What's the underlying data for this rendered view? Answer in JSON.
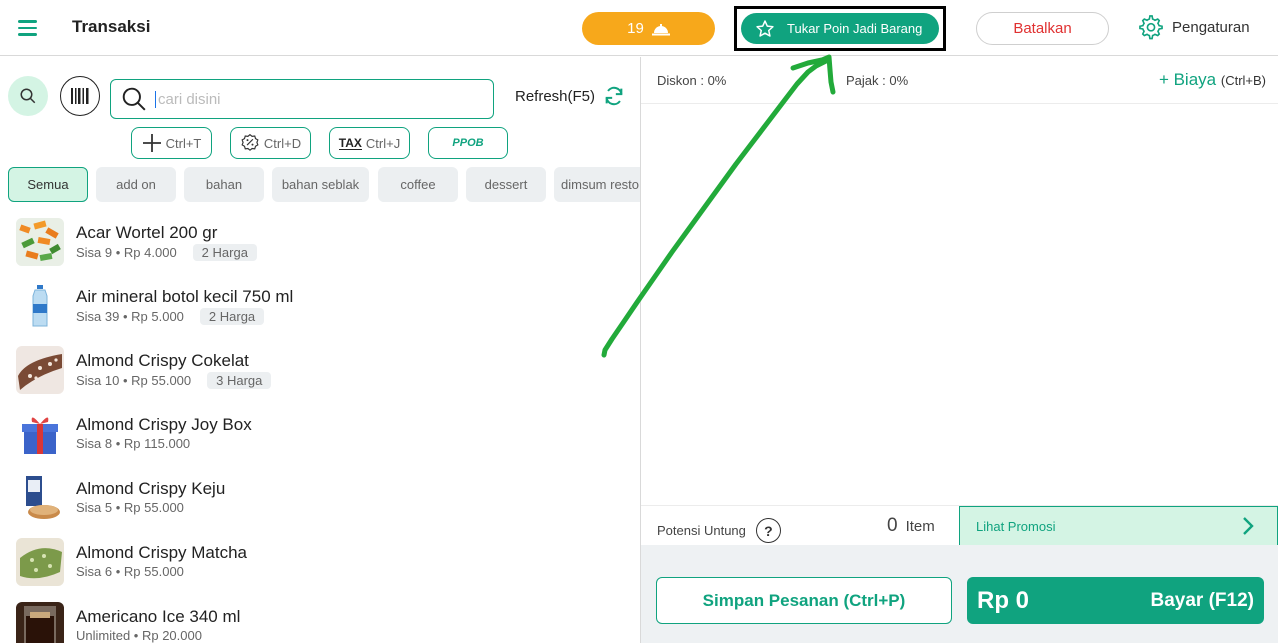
{
  "header": {
    "title": "Transaksi",
    "queue_count": "19",
    "tukar_label": "Tukar Poin Jadi Barang",
    "batal_label": "Batalkan",
    "setting_label": "Pengaturan"
  },
  "search": {
    "placeholder": "cari disini",
    "refresh_label": "Refresh(F5)"
  },
  "shortcuts": {
    "add": "Ctrl+T",
    "discount": "Ctrl+D",
    "tax": "Ctrl+J",
    "tax_icon_text": "TAX",
    "ppob": "PPOB"
  },
  "categories": [
    "Semua",
    "add on",
    "bahan",
    "bahan seblak",
    "coffee",
    "dessert",
    "dimsum resto"
  ],
  "products": [
    {
      "name": "Acar Wortel 200 gr",
      "meta": "Sisa 9 • Rp 4.000",
      "badge": "2 Harga"
    },
    {
      "name": "Air mineral botol kecil 750 ml",
      "meta": "Sisa 39 • Rp 5.000",
      "badge": "2 Harga"
    },
    {
      "name": "Almond Crispy Cokelat",
      "meta": "Sisa 10 • Rp 55.000",
      "badge": "3 Harga"
    },
    {
      "name": "Almond Crispy Joy Box",
      "meta": "Sisa 8 • Rp 115.000",
      "badge": ""
    },
    {
      "name": "Almond Crispy Keju",
      "meta": "Sisa 5 • Rp 55.000",
      "badge": ""
    },
    {
      "name": "Almond Crispy Matcha",
      "meta": "Sisa 6 • Rp 55.000",
      "badge": ""
    },
    {
      "name": "Americano Ice 340 ml",
      "meta": "Unlimited • Rp 20.000",
      "badge": ""
    }
  ],
  "cart": {
    "diskon": "Diskon : 0%",
    "pajak": "Pajak : 0%",
    "biaya": "+ Biaya",
    "biaya_shortcut": "(Ctrl+B)",
    "potensi": "Potensi Untung",
    "help_mark": "?",
    "item_count": "0",
    "item_label": "Item",
    "promo_label": "Lihat Promosi",
    "simpan_label": "Simpan Pesanan (Ctrl+P)",
    "total": "Rp 0",
    "bayar_label": "Bayar (F12)"
  },
  "colors": {
    "primary": "#10a37f",
    "accent_orange": "#f7a81b",
    "danger": "#e03131",
    "annotation_arrow": "#22aa3a"
  }
}
